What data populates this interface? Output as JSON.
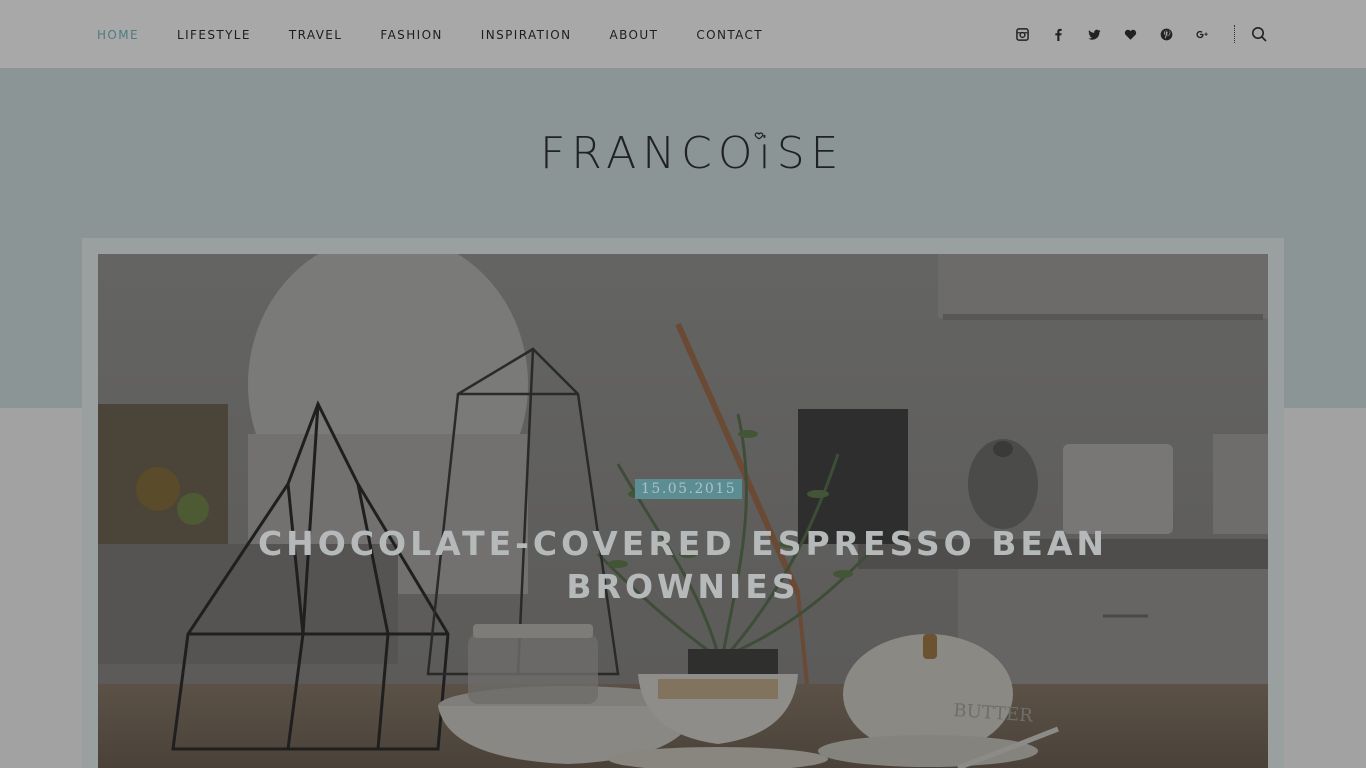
{
  "nav": {
    "items": [
      {
        "label": "HOME",
        "active": true
      },
      {
        "label": "LIFESTYLE"
      },
      {
        "label": "TRAVEL"
      },
      {
        "label": "FASHION"
      },
      {
        "label": "INSPIRATION"
      },
      {
        "label": "ABOUT"
      },
      {
        "label": "CONTACT"
      }
    ]
  },
  "social": {
    "icons": [
      "instagram-icon",
      "facebook-icon",
      "twitter-icon",
      "heart-icon",
      "pinterest-icon",
      "google-plus-icon"
    ]
  },
  "site": {
    "logo": "FRANCOiSE"
  },
  "featured": {
    "date": "15.05.2015",
    "title": "CHOCOLATE-COVERED ESPRESSO BEAN BROWNIES"
  },
  "colors": {
    "accent": "#5c8d92",
    "active_nav": "#4f7b80"
  }
}
